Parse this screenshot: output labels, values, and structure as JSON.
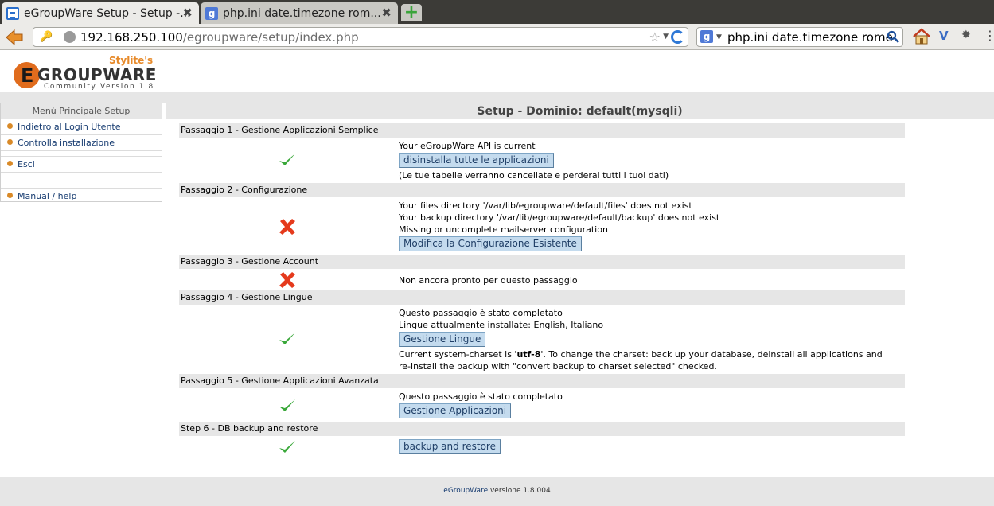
{
  "browser": {
    "tabs": [
      {
        "label": "eGroupWare Setup - Setup -...",
        "active": true
      },
      {
        "label": "php.ini date.timezone rom...",
        "active": false
      }
    ],
    "new_tab_label": "+",
    "url_host": "192.168.250.100",
    "url_path": "/egroupware/setup/index.php",
    "search_value": "php.ini date.timezone rome"
  },
  "logo": {
    "stylite": "Stylite's",
    "e": "E",
    "word": "GROUPWARE",
    "version": "Community Version 1.8"
  },
  "sidebar": {
    "title": "Menù Principale Setup",
    "items": [
      {
        "label": "Indietro al Login Utente"
      },
      {
        "label": "Controlla installazione"
      },
      {
        "label": "Esci"
      },
      {
        "label": "Manual / help"
      }
    ]
  },
  "content": {
    "title": "Setup - Dominio: default(mysqli)",
    "steps": [
      {
        "header": "Passaggio 1 - Gestione Applicazioni Semplice",
        "status": "ok",
        "lines": [
          "Your eGroupWare API is current",
          "(Le tue tabelle verranno cancellate e perderai tutti i tuoi dati)"
        ],
        "button": "disinstalla tutte le applicazioni"
      },
      {
        "header": "Passaggio 2 - Configurazione",
        "status": "error",
        "lines": [
          "Your files directory '/var/lib/egroupware/default/files' does not exist",
          "Your backup directory '/var/lib/egroupware/default/backup' does not exist",
          "Missing or uncomplete mailserver configuration"
        ],
        "button": "Modifica la Configurazione Esistente"
      },
      {
        "header": "Passaggio 3 - Gestione Account",
        "status": "error",
        "lines": [
          "Non ancora pronto per questo passaggio"
        ]
      },
      {
        "header": "Passaggio 4 - Gestione Lingue",
        "status": "ok",
        "lines": [
          "Questo passaggio è stato completato",
          "Lingue attualmente installate: English, Italiano",
          "re-install the backup with \"convert backup to charset selected\" checked."
        ],
        "charset_prefix": "Current system-charset is '",
        "charset_value": "utf-8",
        "charset_suffix": "'. To change the charset: back up your database, deinstall all applications and",
        "button": "Gestione Lingue"
      },
      {
        "header": "Passaggio 5 - Gestione Applicazioni Avanzata",
        "status": "ok",
        "lines": [
          "Questo passaggio è stato completato"
        ],
        "button": "Gestione Applicazioni"
      },
      {
        "header": "Step 6 - DB backup and restore",
        "status": "ok",
        "lines": [],
        "button": "backup and restore"
      }
    ]
  },
  "footer": {
    "link": "eGroupWare",
    "text": " versione 1.8.004"
  },
  "colors": {
    "check": "#3aa83a",
    "cross": "#e53a1c",
    "button_bg": "#c4dbee",
    "accent": "#e06c1d"
  }
}
